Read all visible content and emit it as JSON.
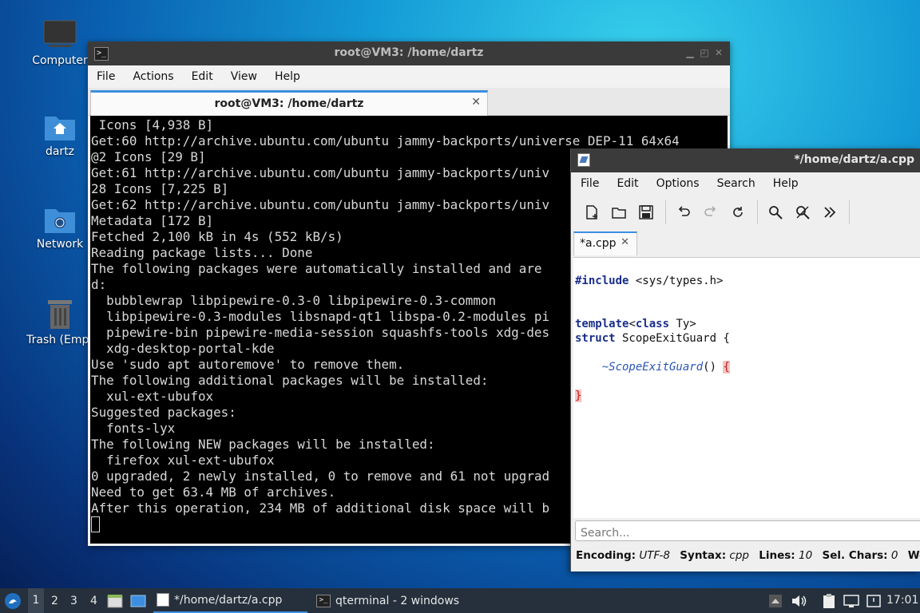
{
  "desktop": {
    "icons": [
      {
        "label": "Computer"
      },
      {
        "label": "dartz"
      },
      {
        "label": "Network"
      },
      {
        "label": "Trash (Empt"
      }
    ]
  },
  "terminal": {
    "title": "root@VM3: /home/dartz",
    "menu": [
      "File",
      "Actions",
      "Edit",
      "View",
      "Help"
    ],
    "tab_label": "root@VM3: /home/dartz",
    "lines": [
      " Icons [4,938 B]",
      "Get:60 http://archive.ubuntu.com/ubuntu jammy-backports/universe DEP-11 64x64",
      "@2 Icons [29 B]",
      "Get:61 http://archive.ubuntu.com/ubuntu jammy-backports/univ",
      "28 Icons [7,225 B]",
      "Get:62 http://archive.ubuntu.com/ubuntu jammy-backports/univ",
      "Metadata [172 B]",
      "Fetched 2,100 kB in 4s (552 kB/s)",
      "Reading package lists... Done",
      "The following packages were automatically installed and are",
      "d:",
      "  bubblewrap libpipewire-0.3-0 libpipewire-0.3-common",
      "  libpipewire-0.3-modules libsnapd-qt1 libspa-0.2-modules pi",
      "  pipewire-bin pipewire-media-session squashfs-tools xdg-des",
      "  xdg-desktop-portal-kde",
      "Use 'sudo apt autoremove' to remove them.",
      "The following additional packages will be installed:",
      "  xul-ext-ubufox",
      "Suggested packages:",
      "  fonts-lyx",
      "The following NEW packages will be installed:",
      "  firefox xul-ext-ubufox",
      "0 upgraded, 2 newly installed, 0 to remove and 61 not upgrad",
      "Need to get 63.4 MB of archives.",
      "After this operation, 234 MB of additional disk space will b"
    ]
  },
  "editor": {
    "title": "*/home/dartz/a.cpp",
    "menu": [
      "File",
      "Edit",
      "Options",
      "Search",
      "Help"
    ],
    "tab_label": "*a.cpp",
    "code": {
      "include_kw": "#include",
      "include_path": " <sys/types.h>",
      "template_kw": "template",
      "template_open": "<",
      "class_kw": "class",
      "template_rest": " Ty>",
      "struct_kw": "struct",
      "struct_rest": " ScopeExitGuard {",
      "indent": "    ",
      "dtor_name": "~ScopeExitGuard",
      "dtor_parens": "() ",
      "open_brace": "{",
      "close_brace": "}"
    },
    "search_placeholder": "Search...",
    "status": {
      "encoding_label": "Encoding:",
      "encoding": "UTF-8",
      "syntax_label": "Syntax:",
      "syntax": "cpp",
      "lines_label": "Lines:",
      "lines": "10",
      "selchars_label": "Sel. Chars:",
      "selchars": "0",
      "words_label": "Words:"
    }
  },
  "taskbar": {
    "workspaces": [
      "1",
      "2",
      "3",
      "4"
    ],
    "tasks": [
      {
        "label": "*/home/dartz/a.cpp"
      },
      {
        "label": "qterminal - 2 windows"
      }
    ],
    "clock": "17:01"
  }
}
